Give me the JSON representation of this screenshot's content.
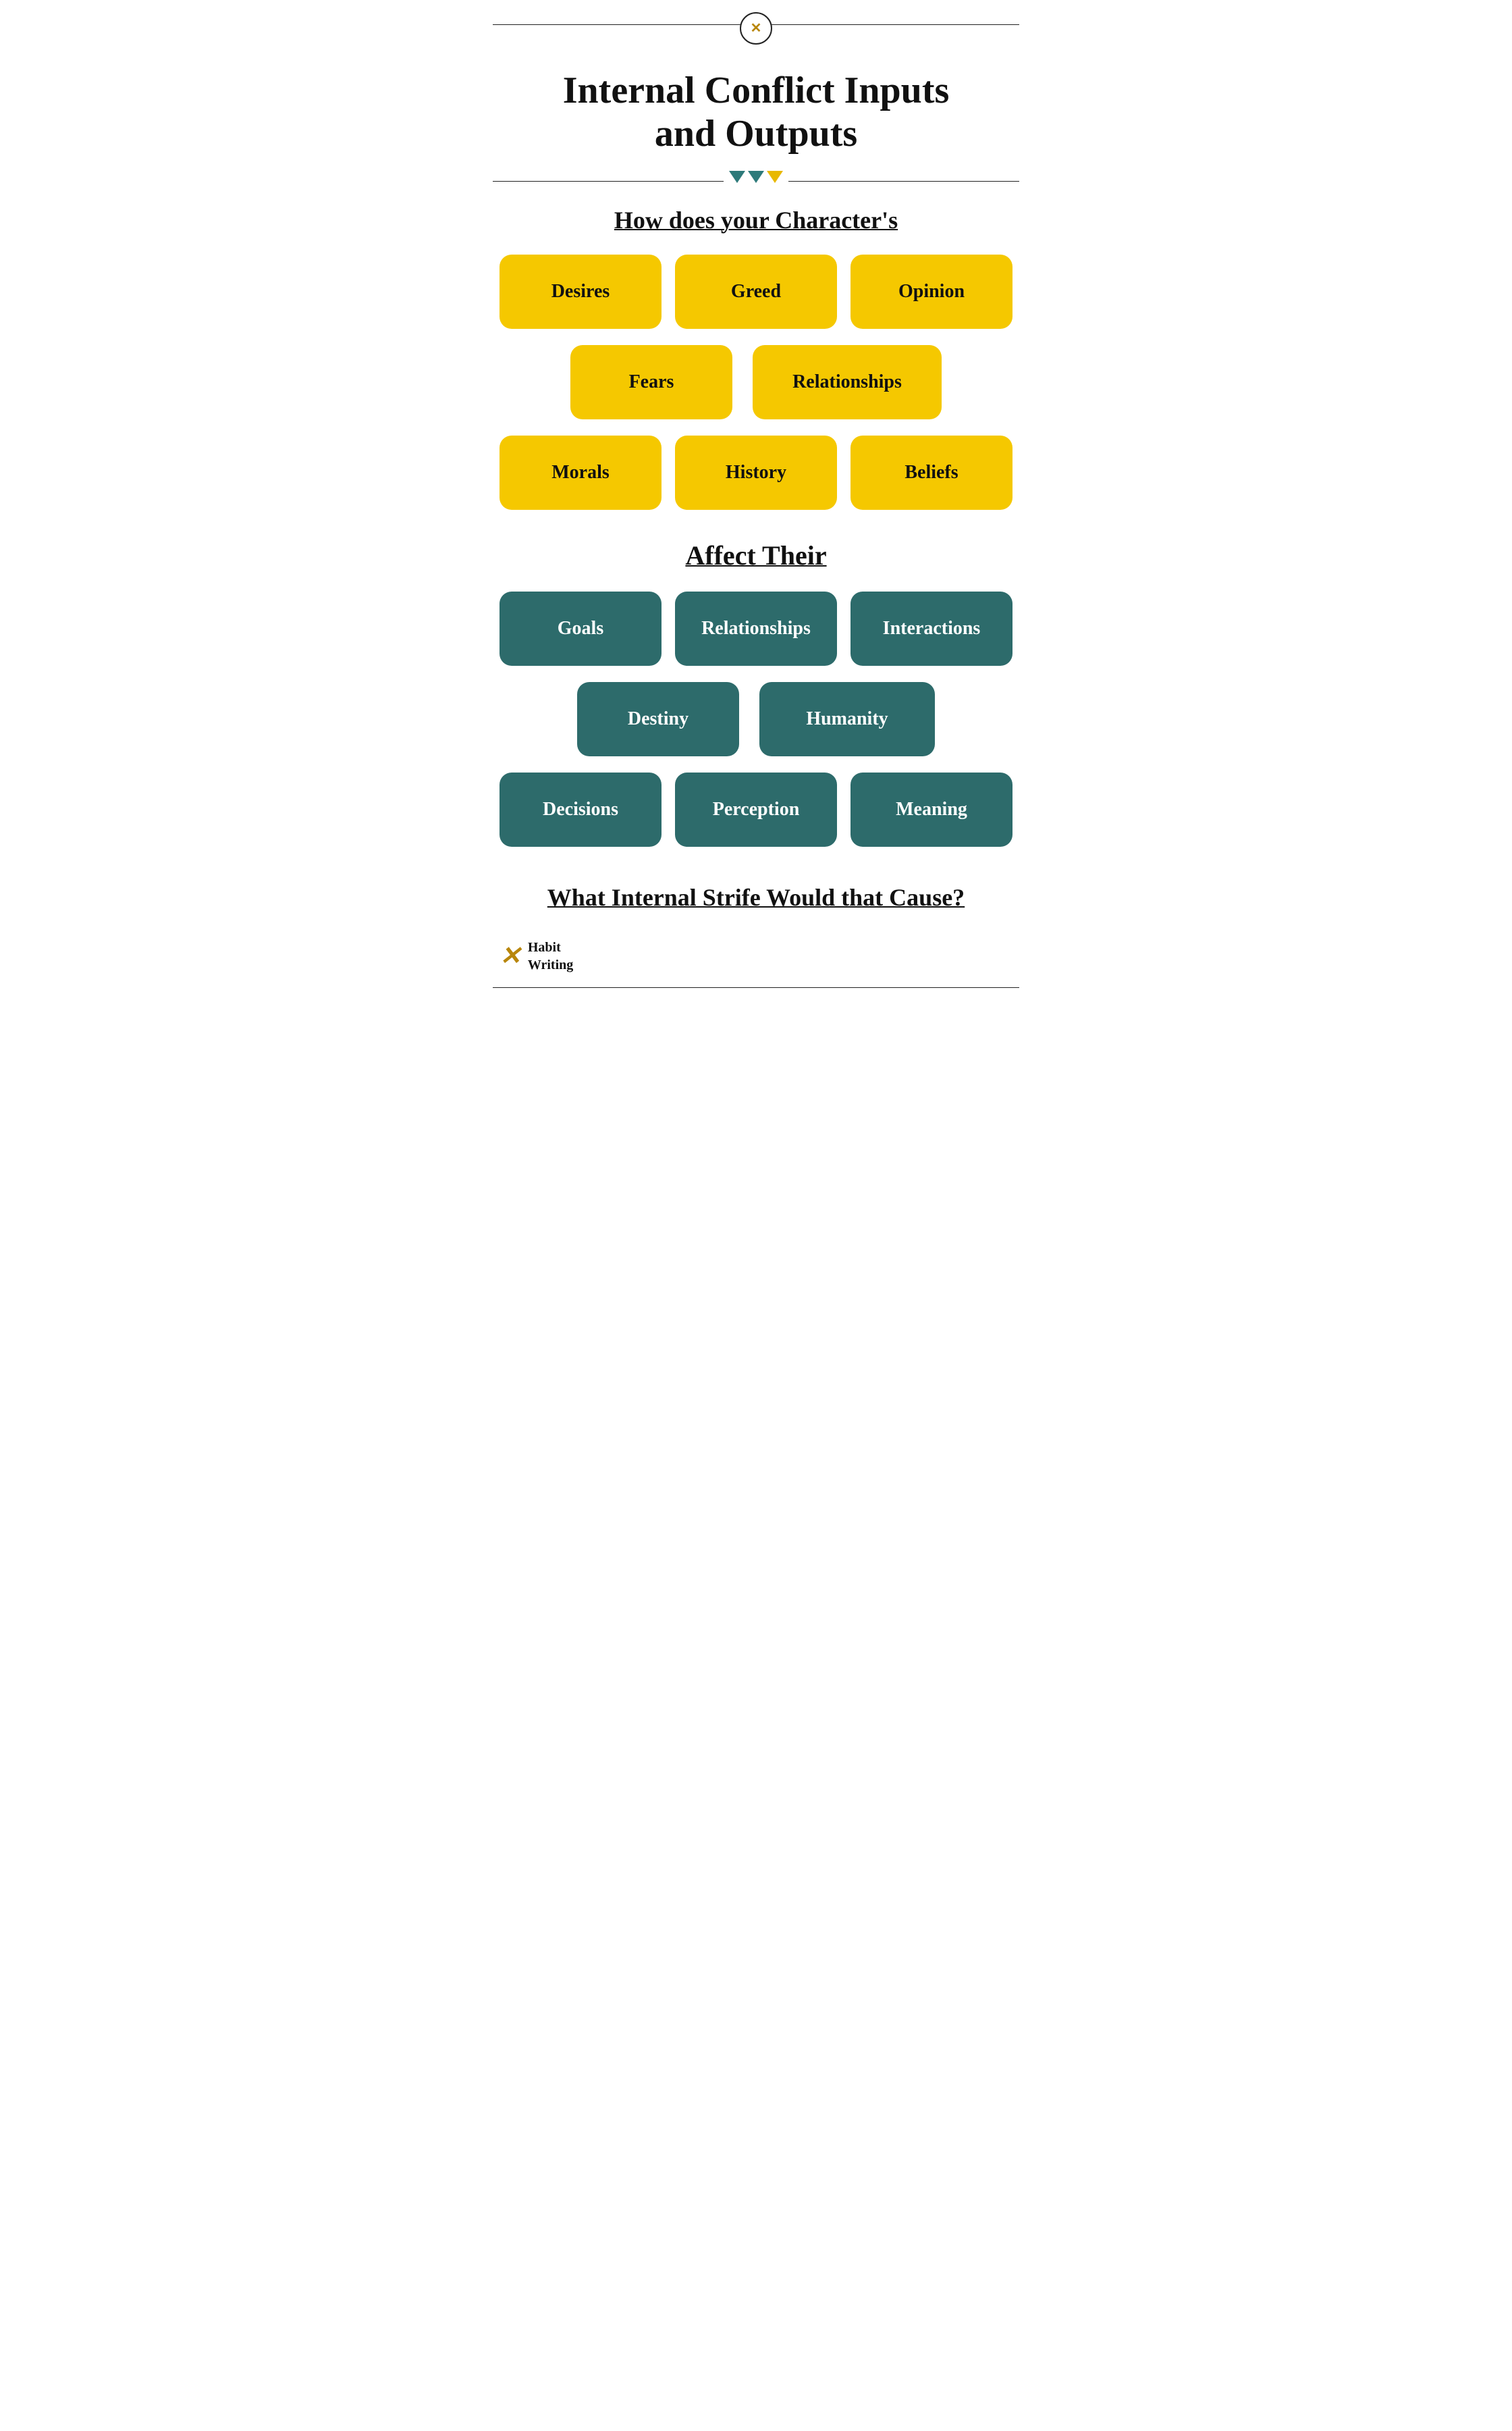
{
  "header": {
    "logo_symbol": "✕",
    "title_line1": "Internal Conflict Inputs",
    "title_line2": "and Outputs"
  },
  "divider": {
    "arrows": [
      "teal",
      "teal",
      "gold"
    ]
  },
  "section_how": {
    "label": "How does your Character's"
  },
  "inputs": {
    "row1": [
      {
        "id": "desires",
        "label": "Desires"
      },
      {
        "id": "greed",
        "label": "Greed"
      },
      {
        "id": "opinion",
        "label": "Opinion"
      }
    ],
    "row2": [
      {
        "id": "fears",
        "label": "Fears"
      },
      {
        "id": "relationships-in",
        "label": "Relationships"
      }
    ],
    "row3": [
      {
        "id": "morals",
        "label": "Morals"
      },
      {
        "id": "history",
        "label": "History"
      },
      {
        "id": "beliefs",
        "label": "Beliefs"
      }
    ]
  },
  "section_affect": {
    "label": "Affect Their"
  },
  "outputs": {
    "row1": [
      {
        "id": "goals",
        "label": "Goals"
      },
      {
        "id": "relationships-out",
        "label": "Relationships"
      },
      {
        "id": "interactions",
        "label": "Interactions"
      }
    ],
    "row2": [
      {
        "id": "destiny",
        "label": "Destiny"
      },
      {
        "id": "humanity",
        "label": "Humanity"
      }
    ],
    "row3": [
      {
        "id": "decisions",
        "label": "Decisions"
      },
      {
        "id": "perception",
        "label": "Perception"
      },
      {
        "id": "meaning",
        "label": "Meaning"
      }
    ]
  },
  "bottom_question": {
    "label": "What Internal Strife Would that Cause?"
  },
  "brand": {
    "name_line1": "Habit",
    "name_line2": "Writing"
  }
}
